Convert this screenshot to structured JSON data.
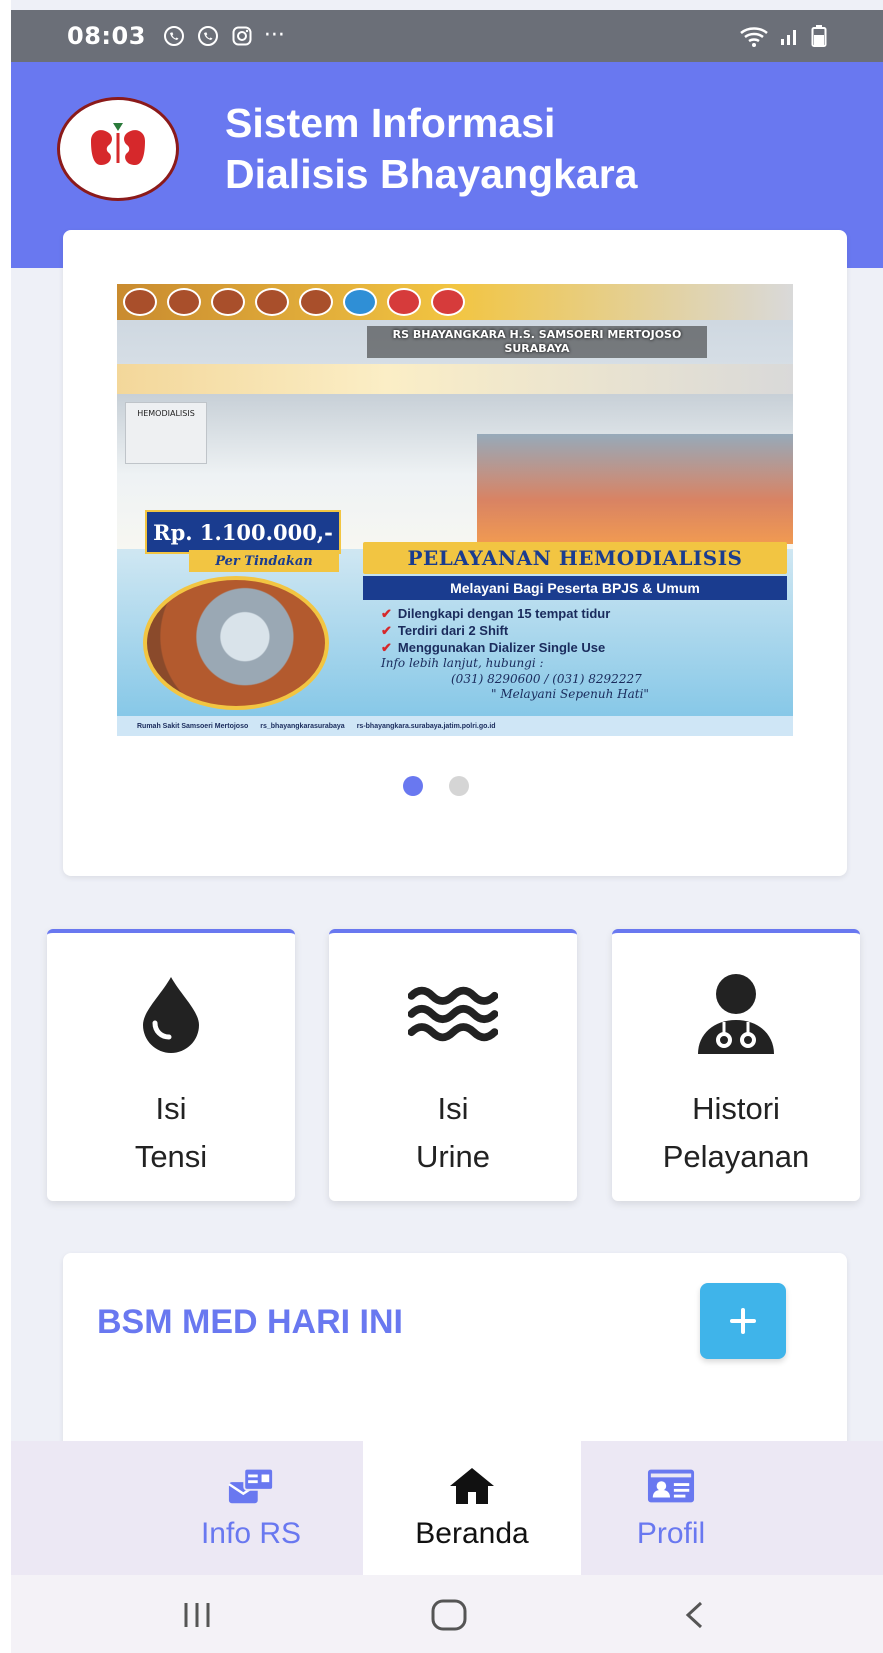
{
  "status_bar": {
    "time": "08:03",
    "notification_icons": [
      "whatsapp-icon",
      "whatsapp-icon",
      "instagram-icon"
    ],
    "more": "···",
    "right_icons": [
      "wifi-icon",
      "signal-icon",
      "battery-icon"
    ]
  },
  "header": {
    "title_line1": "Sistem Informasi",
    "title_line2": "Dialisis Bhayangkara",
    "logo_icon": "sidia-bhara-logo"
  },
  "banner": {
    "hospital": "RS BHAYANGKARA H.S. SAMSOERI MERTOJOSO SURABAYA",
    "unit_sign": "HEMODIALISIS",
    "price": "Rp. 1.100.000,-",
    "price_note": "Per Tindakan",
    "headline": "PELAYANAN HEMODIALISIS",
    "subheadline": "Melayani Bagi Peserta BPJS & Umum",
    "features": [
      "Dilengkapi dengan 15 tempat tidur",
      "Terdiri dari 2 Shift",
      "Menggunakan Dializer Single Use"
    ],
    "info_label": "Info lebih lanjut, hubungi :",
    "phones": "(031) 8290600 / (031) 8292227",
    "motto": "\" Melayani Sepenuh Hati\"",
    "footer_fb": "Rumah Sakit Samsoeri Mertojoso",
    "footer_ig": "rs_bhayangkarasurabaya",
    "footer_web": "rs-bhayangkara.surabaya.jatim.polri.go.id"
  },
  "slider": {
    "total_slides": 2,
    "active_index": 0
  },
  "menu": [
    {
      "line1": "Isi",
      "line2": "Tensi",
      "icon": "blood-drop-icon"
    },
    {
      "line1": "Isi",
      "line2": "Urine",
      "icon": "water-waves-icon"
    },
    {
      "line1": "Histori",
      "line2": "Pelayanan",
      "icon": "doctor-icon"
    }
  ],
  "bsm": {
    "title": "BSM MED HARI INI",
    "add_label": "+"
  },
  "bottom_nav": [
    {
      "label": "Info RS",
      "icon": "hospital-info-icon",
      "active": false
    },
    {
      "label": "Beranda",
      "icon": "home-icon",
      "active": true
    },
    {
      "label": "Profil",
      "icon": "id-card-icon",
      "active": false
    }
  ],
  "colors": {
    "primary": "#6978f0",
    "accent_button": "#3fb4ea",
    "status_bar": "#6b6f78",
    "background": "#eef0f7"
  }
}
